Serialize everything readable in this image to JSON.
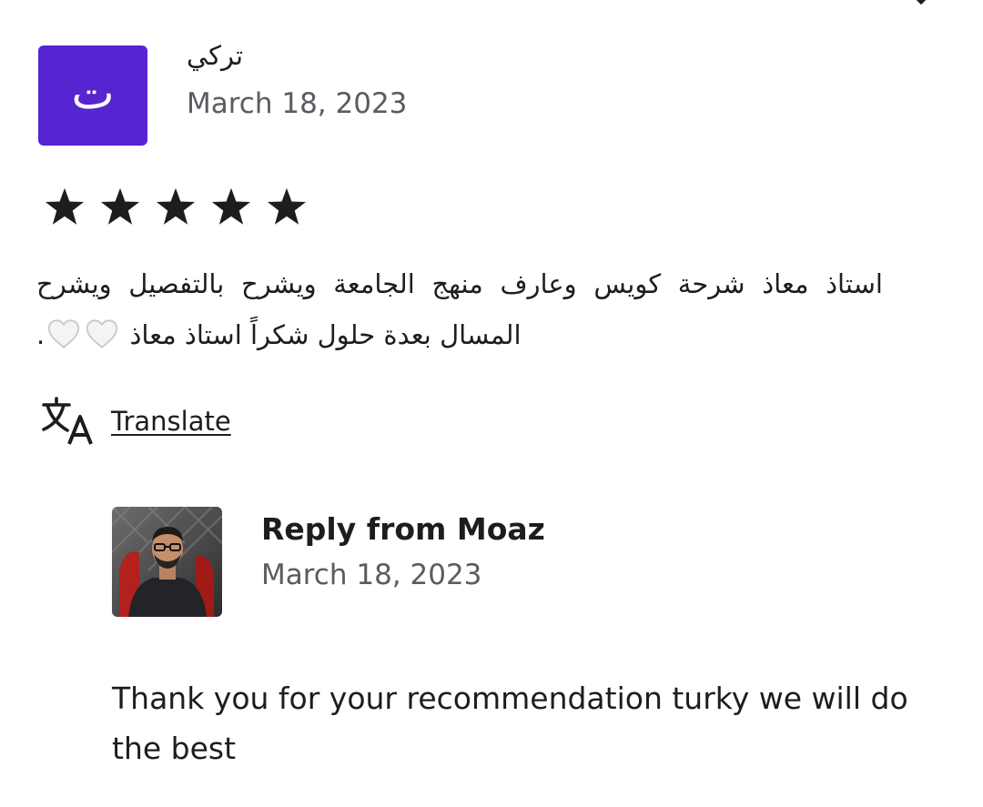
{
  "review": {
    "avatar_letter": "ت",
    "avatar_color": "#5624d0",
    "reviewer_name": "تركي",
    "date": "March 18, 2023",
    "rating": 5,
    "max_rating": 5,
    "text_line_1": "استاذ معاذ شرحة كويس وعارف منهج الجامعة ويشرح بالتفصيل ويشرح",
    "text_line_2_start": "المسال بعدة حلول شكراً استاذ معاذ",
    "text_line_2_end": "."
  },
  "translate": {
    "icon": "translate-icon",
    "label": "Translate"
  },
  "reply": {
    "title": "Reply from Moaz",
    "date": "March 18, 2023",
    "text": "Thank you for your recommendation turky we will do the best"
  },
  "icons": {
    "close": "close-icon",
    "star": "star-icon",
    "heart": "white-heart-icon"
  }
}
